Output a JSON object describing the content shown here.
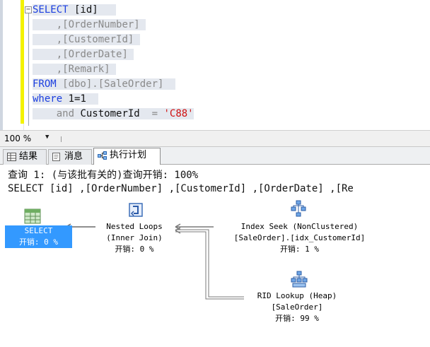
{
  "editor": {
    "lines": [
      {
        "pre": "",
        "kw": "SELECT",
        "rest": " [id]"
      },
      {
        "pre": "    ,",
        "kw": "",
        "rest": "[OrderNumber]"
      },
      {
        "pre": "    ,",
        "kw": "",
        "rest": "[CustomerId]"
      },
      {
        "pre": "    ,",
        "kw": "",
        "rest": "[OrderDate]"
      },
      {
        "pre": "    ,",
        "kw": "",
        "rest": "[Remark]"
      },
      {
        "pre": "",
        "kw": "FROM",
        "rest": " [dbo].[SaleOrder]"
      },
      {
        "pre": "",
        "kw": "where",
        "rest": " 1=1"
      }
    ],
    "last_line": {
      "and": "and",
      "col": " CustomerId ",
      "eq": " =",
      "str": " 'C88'"
    }
  },
  "status": {
    "zoom": "100 %"
  },
  "tabs": [
    {
      "label": "结果",
      "icon": "grid-icon"
    },
    {
      "label": "消息",
      "icon": "message-icon"
    },
    {
      "label": "执行计划",
      "icon": "plan-icon"
    }
  ],
  "plan": {
    "query_header": "查询 1: (与该批有关的)查询开销: 100%",
    "query_text": "SELECT [id] ,[OrderNumber] ,[CustomerId] ,[OrderDate] ,[Re",
    "nodes": {
      "select": {
        "name": "SELECT",
        "cost": "开销: 0 %"
      },
      "nested": {
        "name": "Nested Loops",
        "sub": "(Inner Join)",
        "cost": "开销: 0 %"
      },
      "seek": {
        "name": "Index Seek (NonClustered)",
        "sub": "[SaleOrder].[idx_CustomerId]",
        "cost": "开销: 1 %"
      },
      "rid": {
        "name": "RID Lookup (Heap)",
        "sub": "[SaleOrder]",
        "cost": "开销: 99 %"
      }
    }
  },
  "colors": {
    "keyword": "#1c3fe0",
    "string": "#d01010",
    "selection": "#3399ff"
  }
}
